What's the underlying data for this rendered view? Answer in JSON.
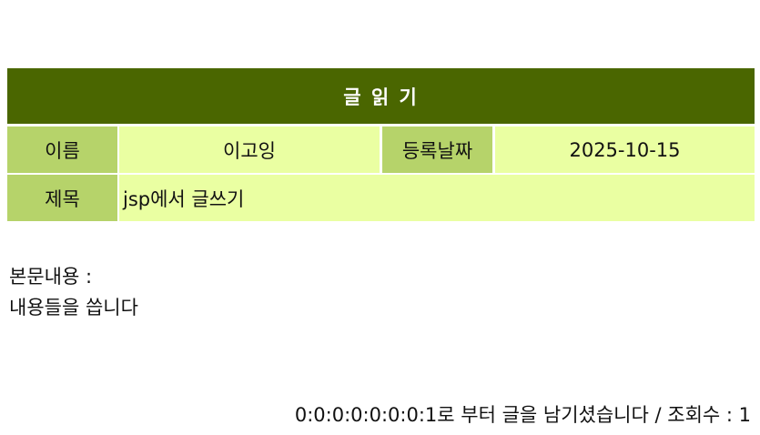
{
  "board": {
    "title": "글 읽 기",
    "name_label": "이름",
    "name_value": "이고잉",
    "date_label": "등록날짜",
    "date_value": "2025-10-15",
    "subject_label": "제목",
    "subject_value": "jsp에서 글쓰기"
  },
  "content": {
    "label": "본문내용 :",
    "body": "내용들을 씁니다"
  },
  "footer": {
    "text": "0:0:0:0:0:0:0:1로 부터 글을 남기셨습니다 / 조회수 : 1"
  },
  "colors": {
    "header_bg": "#4a6600",
    "label_bg": "#b6d36a",
    "value_bg": "#eaffa2"
  }
}
